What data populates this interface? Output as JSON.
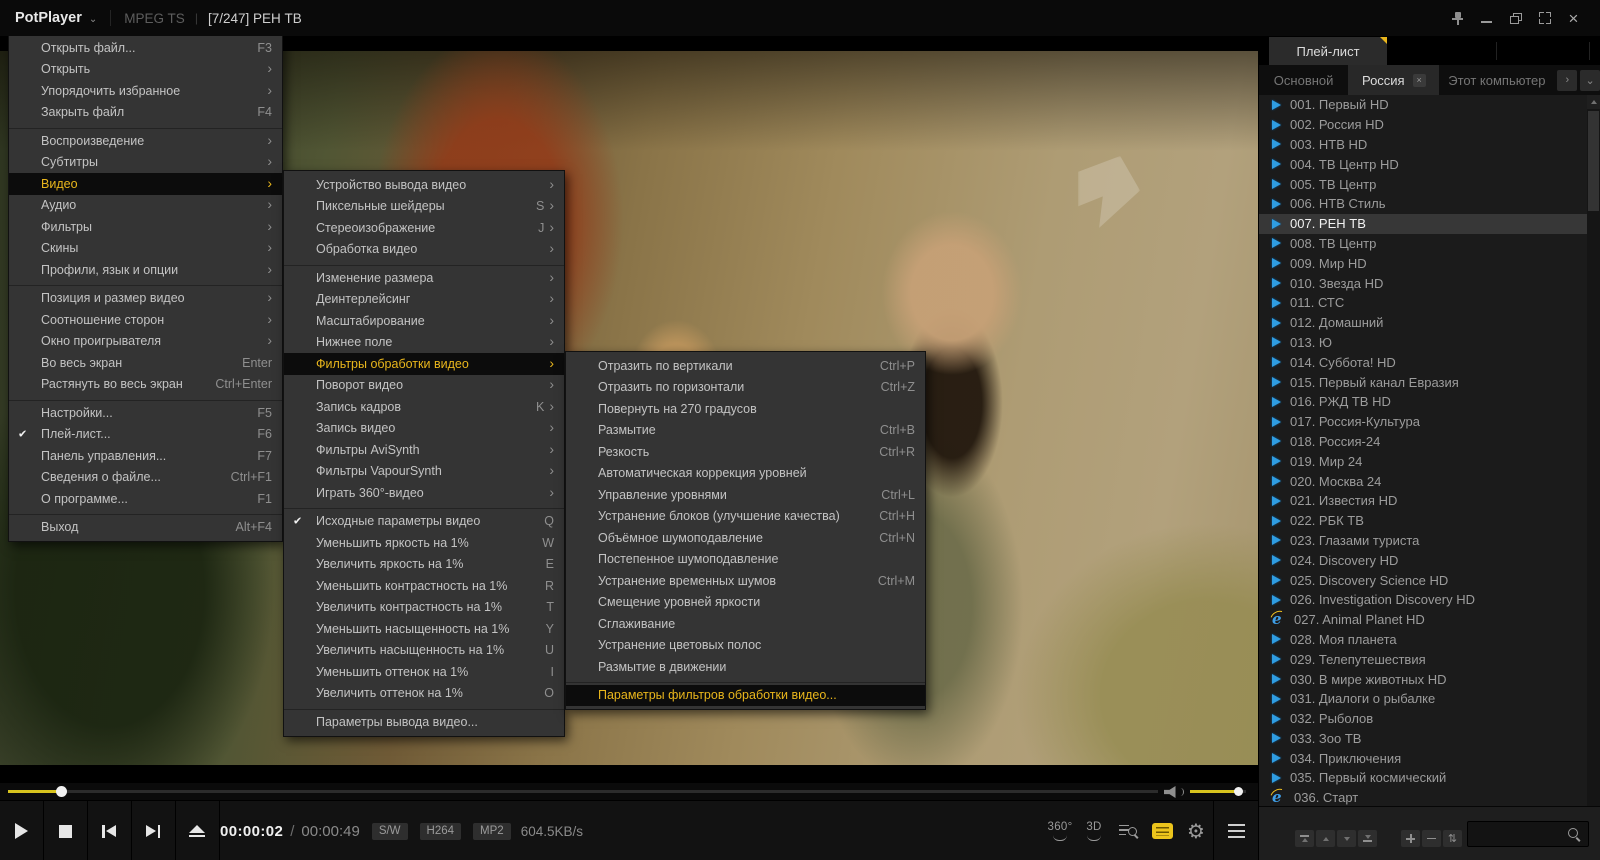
{
  "icons": {
    "chevron-down": "⌄",
    "check": "✔",
    "submenu-arrow": "›",
    "tab-close": "×",
    "tab-next": "›",
    "tab-dropdown": "⌄",
    "window-close": "×",
    "sort": "⇅",
    "gear": "⚙"
  },
  "colors": {
    "accent_yellow": "#e9b61c",
    "menu_bg": "#343434",
    "menu_highlight_bg": "#0c0c0c",
    "selection_bg": "#373737",
    "playlist_icon_blue": "#2f9de2",
    "seek_fill": "#d8c41e"
  },
  "title_bar": {
    "app": "PotPlayer",
    "format": "MPEG TS",
    "pipe": "|",
    "media_title": "[7/247] РЕН ТВ"
  },
  "main_menu": {
    "items": [
      {
        "label": "Открыть файл...",
        "shortcut": "F3"
      },
      {
        "label": "Открыть",
        "submenu": true
      },
      {
        "label": "Упорядочить избранное",
        "submenu": true
      },
      {
        "label": "Закрыть файл",
        "shortcut": "F4"
      },
      {
        "sep": true
      },
      {
        "label": "Воспроизведение",
        "submenu": true
      },
      {
        "label": "Субтитры",
        "submenu": true
      },
      {
        "label": "Видео",
        "submenu": true,
        "highlighted": true
      },
      {
        "label": "Аудио",
        "submenu": true
      },
      {
        "label": "Фильтры",
        "submenu": true
      },
      {
        "label": "Скины",
        "submenu": true
      },
      {
        "label": "Профили, язык и опции",
        "submenu": true
      },
      {
        "sep": true
      },
      {
        "label": "Позиция и размер видео",
        "submenu": true
      },
      {
        "label": "Соотношение сторон",
        "submenu": true
      },
      {
        "label": "Окно проигрывателя",
        "submenu": true
      },
      {
        "label": "Во весь экран",
        "shortcut": "Enter"
      },
      {
        "label": "Растянуть во весь экран",
        "shortcut": "Ctrl+Enter"
      },
      {
        "sep": true
      },
      {
        "label": "Настройки...",
        "shortcut": "F5"
      },
      {
        "label": "Плей-лист...",
        "shortcut": "F6",
        "checked": true
      },
      {
        "label": "Панель управления...",
        "shortcut": "F7"
      },
      {
        "label": "Сведения о файле...",
        "shortcut": "Ctrl+F1"
      },
      {
        "label": "О программе...",
        "shortcut": "F1"
      },
      {
        "sep": true
      },
      {
        "label": "Выход",
        "shortcut": "Alt+F4"
      }
    ]
  },
  "video_menu": {
    "items": [
      {
        "label": "Устройство вывода видео",
        "submenu": true
      },
      {
        "label": "Пиксельные шейдеры",
        "shortcut": "S",
        "submenu": true
      },
      {
        "label": "Стереоизображение",
        "shortcut": "J",
        "submenu": true
      },
      {
        "label": "Обработка видео",
        "submenu": true
      },
      {
        "sep": true
      },
      {
        "label": "Изменение размера",
        "submenu": true
      },
      {
        "label": "Деинтерлейсинг",
        "submenu": true
      },
      {
        "label": "Масштабирование",
        "submenu": true
      },
      {
        "label": "Нижнее поле",
        "submenu": true
      },
      {
        "label": "Фильтры обработки видео",
        "submenu": true,
        "highlighted": true
      },
      {
        "label": "Поворот видео",
        "submenu": true
      },
      {
        "label": "Запись кадров",
        "shortcut": "K",
        "submenu": true
      },
      {
        "label": "Запись видео",
        "submenu": true
      },
      {
        "label": "Фильтры AviSynth",
        "submenu": true
      },
      {
        "label": "Фильтры VapourSynth",
        "submenu": true
      },
      {
        "label": "Играть 360°-видео",
        "submenu": true
      },
      {
        "sep": true
      },
      {
        "label": "Исходные параметры видео",
        "shortcut": "Q",
        "checked": true
      },
      {
        "label": "Уменьшить яркость на 1%",
        "shortcut": "W"
      },
      {
        "label": "Увеличить яркость на 1%",
        "shortcut": "E"
      },
      {
        "label": "Уменьшить контрастность на 1%",
        "shortcut": "R"
      },
      {
        "label": "Увеличить контрастность на 1%",
        "shortcut": "T"
      },
      {
        "label": "Уменьшить насыщенность на 1%",
        "shortcut": "Y"
      },
      {
        "label": "Увеличить насыщенность на 1%",
        "shortcut": "U"
      },
      {
        "label": "Уменьшить оттенок на 1%",
        "shortcut": "I"
      },
      {
        "label": "Увеличить оттенок на 1%",
        "shortcut": "O"
      },
      {
        "sep": true
      },
      {
        "label": "Параметры вывода видео..."
      }
    ]
  },
  "filters_menu": {
    "items": [
      {
        "label": "Отразить по вертикали",
        "shortcut": "Ctrl+P"
      },
      {
        "label": "Отразить по горизонтали",
        "shortcut": "Ctrl+Z"
      },
      {
        "label": "Повернуть на 270 градусов"
      },
      {
        "label": "Размытие",
        "shortcut": "Ctrl+B"
      },
      {
        "label": "Резкость",
        "shortcut": "Ctrl+R"
      },
      {
        "label": "Автоматическая коррекция уровней"
      },
      {
        "label": "Управление уровнями",
        "shortcut": "Ctrl+L"
      },
      {
        "label": "Устранение блоков (улучшение качества)",
        "shortcut": "Ctrl+H"
      },
      {
        "label": "Объёмное шумоподавление",
        "shortcut": "Ctrl+N"
      },
      {
        "label": "Постепенное шумоподавление"
      },
      {
        "label": "Устранение временных шумов",
        "shortcut": "Ctrl+M"
      },
      {
        "label": "Смещение уровней яркости"
      },
      {
        "label": "Сглаживание"
      },
      {
        "label": "Устранение цветовых полос"
      },
      {
        "label": "Размытие в движении"
      },
      {
        "sep": true
      },
      {
        "label": "Параметры фильтров обработки видео...",
        "highlighted": true
      }
    ]
  },
  "playlist": {
    "panel_title": "Плей-лист",
    "tabs": {
      "main": "Основной",
      "active": "Россия",
      "computer": "Этот компьютер"
    },
    "search_value": "",
    "channels": [
      {
        "label": "001. Первый HD"
      },
      {
        "label": "002. Россия HD"
      },
      {
        "label": "003. НТВ HD"
      },
      {
        "label": "004. ТВ Центр HD"
      },
      {
        "label": "005. ТВ Центр"
      },
      {
        "label": "006. НТВ Стиль"
      },
      {
        "label": "007. РЕН ТВ",
        "selected": true
      },
      {
        "label": "008. ТВ Центр"
      },
      {
        "label": "009. Мир HD"
      },
      {
        "label": "010. Звезда HD"
      },
      {
        "label": "011. СТС"
      },
      {
        "label": "012. Домашний"
      },
      {
        "label": "013. Ю"
      },
      {
        "label": "014. Суббота! HD"
      },
      {
        "label": "015. Первый канал Евразия"
      },
      {
        "label": "016. РЖД ТВ HD"
      },
      {
        "label": "017. Россия-Культура"
      },
      {
        "label": "018. Россия-24"
      },
      {
        "label": "019. Мир 24"
      },
      {
        "label": "020. Москва 24"
      },
      {
        "label": "021. Известия HD"
      },
      {
        "label": "022. РБК ТВ"
      },
      {
        "label": "023. Глазами туриста"
      },
      {
        "label": "024. Discovery HD"
      },
      {
        "label": "025. Discovery Science HD"
      },
      {
        "label": "026. Investigation Discovery HD"
      },
      {
        "label": "027. Animal Planet HD",
        "ie": true
      },
      {
        "label": "028. Моя планета"
      },
      {
        "label": "029. Телепутешествия"
      },
      {
        "label": "030. В мире животных HD"
      },
      {
        "label": "031. Диалоги о рыбалке"
      },
      {
        "label": "032. Рыболов"
      },
      {
        "label": "033. Зоо ТВ"
      },
      {
        "label": "034. Приключения"
      },
      {
        "label": "035. Первый космический"
      },
      {
        "label": "036. Старт",
        "ie": true
      }
    ]
  },
  "controls": {
    "time_current": "00:00:02",
    "time_separator": "/",
    "time_total": "00:00:49",
    "badges": {
      "render": "S/W",
      "video_codec": "H264",
      "audio_codec": "MP2"
    },
    "bitrate": "604.5KB/s",
    "deg360_label": "360°",
    "threed_label": "3D",
    "seek_position_percent": 5,
    "volume_percent": 85
  }
}
